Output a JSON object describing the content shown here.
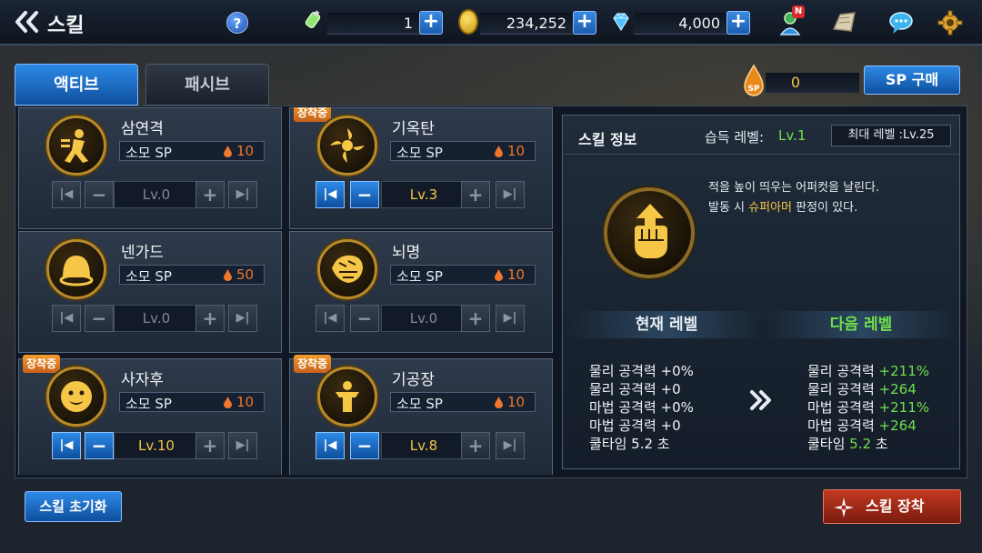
{
  "header": {
    "back_icon": "double-chevron-left-icon",
    "title": "스킬",
    "help_label": "?",
    "resources": [
      {
        "name": "energy",
        "icon": "energy-syringe-icon",
        "value": "1"
      },
      {
        "name": "gold",
        "icon": "gold-coin-icon",
        "value": "234,252"
      },
      {
        "name": "gem",
        "icon": "diamond-icon",
        "value": "4,000"
      }
    ],
    "plus_label": "+",
    "new_badge": "N",
    "icons": [
      "character-icon",
      "map-icon",
      "chat-icon",
      "settings-gear-icon"
    ]
  },
  "tabs": [
    {
      "label": "액티브",
      "active": true
    },
    {
      "label": "패시브",
      "active": false
    }
  ],
  "sp": {
    "value": "0",
    "buy_label": "SP 구매",
    "icon": "sp-flame-icon"
  },
  "cost_label": "소모 SP",
  "equip_badge_label": "장착중",
  "skills": [
    {
      "name": "삼연격",
      "cost": "10",
      "level": "Lv.0",
      "equipped": false,
      "active": false
    },
    {
      "name": "기옥탄",
      "cost": "10",
      "level": "Lv.3",
      "equipped": true,
      "active": true
    },
    {
      "name": "넨가드",
      "cost": "50",
      "level": "Lv.0",
      "equipped": false,
      "active": false
    },
    {
      "name": "뇌명",
      "cost": "10",
      "level": "Lv.0",
      "equipped": false,
      "active": false
    },
    {
      "name": "사자후",
      "cost": "10",
      "level": "Lv.10",
      "equipped": true,
      "active": true
    },
    {
      "name": "기공장",
      "cost": "10",
      "level": "Lv.8",
      "equipped": true,
      "active": true
    }
  ],
  "control_glyphs": {
    "first": "|◀",
    "minus": "−",
    "plus": "+",
    "last": "▶|"
  },
  "info": {
    "title": "스킬 정보",
    "learn_label": "습득 레벨:",
    "learn_value": "Lv.1",
    "max_level": "최대 레벨 :Lv.25",
    "desc_line1": "적을 높이 띄우는 어퍼컷을 날린다.",
    "desc_line2_pre": "발동 시 ",
    "desc_line2_hl": "슈퍼아머",
    "desc_line2_post": " 판정이 있다.",
    "current_head": "현재 레벨",
    "next_head": "다음 레벨",
    "current_stats": [
      "물리 공격력  +0%",
      "물리 공격력  +0",
      "마법 공격력  +0%",
      "마법 공격력  +0",
      "쿨타임 5.2 초"
    ],
    "next_stats": [
      {
        "label": "물리 공격력 ",
        "value": "+211%",
        "suffix": ""
      },
      {
        "label": "물리 공격력 ",
        "value": "+264",
        "suffix": ""
      },
      {
        "label": "마법 공격력 ",
        "value": "+211%",
        "suffix": ""
      },
      {
        "label": "마법 공격력 ",
        "value": "+264",
        "suffix": ""
      },
      {
        "label": "쿨타임 ",
        "value": "5.2",
        "suffix": " 초"
      }
    ]
  },
  "bottom": {
    "reset_label": "스킬 초기화",
    "equip_label": "스킬 장착"
  },
  "colors": {
    "accent_blue": "#1b6fd0",
    "cost_orange": "#f0772c",
    "level_gold": "#f6c646",
    "next_green": "#6ee04c",
    "equip_red": "#a52a17"
  }
}
